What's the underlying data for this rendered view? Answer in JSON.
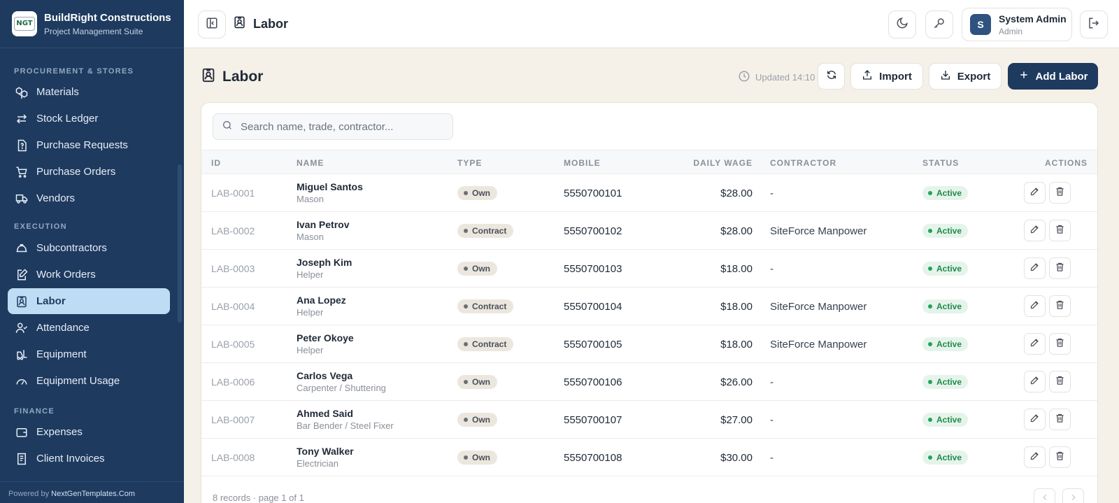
{
  "brand": {
    "name": "BuildRight Constructions",
    "subtitle": "Project Management Suite",
    "logo_text": "NGT"
  },
  "sidebar": {
    "sections": [
      {
        "label": "PROCUREMENT & STORES"
      },
      {
        "label": "EXECUTION"
      },
      {
        "label": "FINANCE"
      }
    ],
    "items": [
      {
        "label": "Materials",
        "icon": "boxes-icon"
      },
      {
        "label": "Stock Ledger",
        "icon": "arrows-swap-icon"
      },
      {
        "label": "Purchase Requests",
        "icon": "file-question-icon"
      },
      {
        "label": "Purchase Orders",
        "icon": "cart-icon"
      },
      {
        "label": "Vendors",
        "icon": "truck-icon"
      },
      {
        "label": "Subcontractors",
        "icon": "hard-hat-icon"
      },
      {
        "label": "Work Orders",
        "icon": "file-edit-icon"
      },
      {
        "label": "Labor",
        "icon": "badge-user-icon",
        "active": true
      },
      {
        "label": "Attendance",
        "icon": "user-check-icon"
      },
      {
        "label": "Equipment",
        "icon": "forklift-icon"
      },
      {
        "label": "Equipment Usage",
        "icon": "gauge-icon"
      },
      {
        "label": "Expenses",
        "icon": "wallet-icon"
      },
      {
        "label": "Client Invoices",
        "icon": "receipt-icon"
      }
    ],
    "powered_prefix": "Powered by",
    "powered_link": "NextGenTemplates.Com"
  },
  "topbar": {
    "title": "Labor"
  },
  "user": {
    "initial": "S",
    "name": "System Admin",
    "role": "Admin"
  },
  "page": {
    "title": "Labor",
    "updated": "Updated 14:10",
    "import_label": "Import",
    "export_label": "Export",
    "add_label": "Add Labor"
  },
  "search": {
    "placeholder": "Search name, trade, contractor..."
  },
  "table": {
    "headers": {
      "id": "ID",
      "name": "NAME",
      "type": "TYPE",
      "mobile": "MOBILE",
      "wage": "DAILY WAGE",
      "contractor": "CONTRACTOR",
      "status": "STATUS",
      "actions": "ACTIONS"
    },
    "rows": [
      {
        "id": "LAB-0001",
        "name": "Miguel Santos",
        "trade": "Mason",
        "type": "Own",
        "mobile": "5550700101",
        "wage": "$28.00",
        "contractor": "-",
        "status": "Active"
      },
      {
        "id": "LAB-0002",
        "name": "Ivan Petrov",
        "trade": "Mason",
        "type": "Contract",
        "mobile": "5550700102",
        "wage": "$28.00",
        "contractor": "SiteForce Manpower",
        "status": "Active"
      },
      {
        "id": "LAB-0003",
        "name": "Joseph Kim",
        "trade": "Helper",
        "type": "Own",
        "mobile": "5550700103",
        "wage": "$18.00",
        "contractor": "-",
        "status": "Active"
      },
      {
        "id": "LAB-0004",
        "name": "Ana Lopez",
        "trade": "Helper",
        "type": "Contract",
        "mobile": "5550700104",
        "wage": "$18.00",
        "contractor": "SiteForce Manpower",
        "status": "Active"
      },
      {
        "id": "LAB-0005",
        "name": "Peter Okoye",
        "trade": "Helper",
        "type": "Contract",
        "mobile": "5550700105",
        "wage": "$18.00",
        "contractor": "SiteForce Manpower",
        "status": "Active"
      },
      {
        "id": "LAB-0006",
        "name": "Carlos Vega",
        "trade": "Carpenter / Shuttering",
        "type": "Own",
        "mobile": "5550700106",
        "wage": "$26.00",
        "contractor": "-",
        "status": "Active"
      },
      {
        "id": "LAB-0007",
        "name": "Ahmed Said",
        "trade": "Bar Bender / Steel Fixer",
        "type": "Own",
        "mobile": "5550700107",
        "wage": "$27.00",
        "contractor": "-",
        "status": "Active"
      },
      {
        "id": "LAB-0008",
        "name": "Tony Walker",
        "trade": "Electrician",
        "type": "Own",
        "mobile": "5550700108",
        "wage": "$30.00",
        "contractor": "-",
        "status": "Active"
      }
    ],
    "footer": "8 records · page 1 of 1"
  },
  "colors": {
    "sidebar_bg": "#1e3a5f",
    "active_bg": "#bfdcf5",
    "primary": "#1e3a5f",
    "page_bg": "#f5f1e8",
    "status_green": "#1f8a4c"
  }
}
